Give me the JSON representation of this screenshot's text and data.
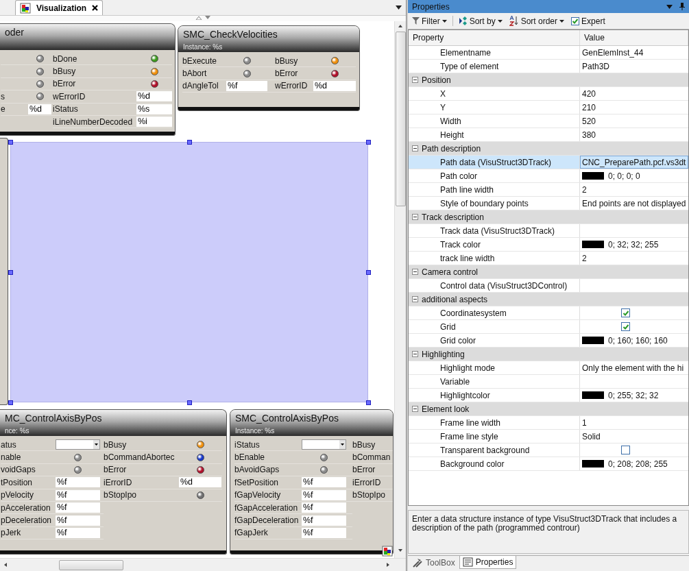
{
  "editor": {
    "tabs": [
      {
        "label": "Visualization",
        "selected": true
      }
    ]
  },
  "canvas": {
    "blocks": [
      {
        "title": "oder",
        "columns": [
          [
            {
              "kind": "lamp",
              "color": "#8a8a8a"
            },
            {
              "kind": "lamp",
              "color": "#8a8a8a"
            },
            {
              "kind": "lamp",
              "color": "#8a8a8a"
            },
            {
              "label": "s",
              "kind": "lamp",
              "color": "#8a8a8a"
            },
            {
              "label": "e",
              "kind": "field",
              "value": "%d"
            }
          ],
          [
            {
              "label": "bDone",
              "kind": "lamp",
              "color": "#3c9a1c"
            },
            {
              "label": "bBusy",
              "kind": "lamp",
              "color": "#f0900c"
            },
            {
              "label": "bError",
              "kind": "lamp",
              "color": "#b0102a"
            },
            {
              "label": "wErrorID",
              "kind": "field",
              "value": "%d"
            },
            {
              "label": "iStatus",
              "kind": "field",
              "value": "%s"
            },
            {
              "label": "iLineNumberDecoded",
              "kind": "field",
              "value": "%i"
            }
          ]
        ]
      },
      {
        "title": "SMC_CheckVelocities",
        "instance": "Instance: %s",
        "columns": [
          [
            {
              "label": "bExecute",
              "kind": "lamp",
              "color": "#8a8a8a"
            },
            {
              "label": "bAbort",
              "kind": "lamp",
              "color": "#8a8a8a"
            },
            {
              "label": "dAngleTol",
              "kind": "field",
              "value": "%f"
            }
          ],
          [
            {
              "label": "bBusy",
              "kind": "lamp",
              "color": "#f0900c"
            },
            {
              "label": "bError",
              "kind": "lamp",
              "color": "#b0102a"
            },
            {
              "label": "wErrorID",
              "kind": "field",
              "value": "%d"
            }
          ]
        ]
      },
      {
        "title": "MC_ControlAxisByPos",
        "instance": "nce: %s",
        "columns": [
          [
            {
              "label": "atus",
              "kind": "dropdown"
            },
            {
              "label": "nable",
              "kind": "lamp",
              "color": "#8a8a8a"
            },
            {
              "label": "voidGaps",
              "kind": "lamp",
              "color": "#8a8a8a"
            },
            {
              "label": "tPosition",
              "kind": "field",
              "value": "%f"
            },
            {
              "label": "pVelocity",
              "kind": "field",
              "value": "%f"
            },
            {
              "label": "pAcceleration",
              "kind": "field",
              "value": "%f"
            },
            {
              "label": "pDeceleration",
              "kind": "field",
              "value": "%f"
            },
            {
              "label": "pJerk",
              "kind": "field",
              "value": "%f"
            }
          ],
          [
            {
              "label": "bBusy",
              "kind": "lamp",
              "color": "#f0900c"
            },
            {
              "label": "bCommandAbortec",
              "kind": "lamp",
              "color": "#1838c8"
            },
            {
              "label": "bError",
              "kind": "lamp",
              "color": "#b0102a"
            },
            {
              "label": "iErrorID",
              "kind": "field",
              "value": "%d"
            },
            {
              "label": "bStopIpo",
              "kind": "lamp",
              "color": "#707070"
            }
          ]
        ]
      },
      {
        "title": "SMC_ControlAxisByPos",
        "instance": "Instance: %s",
        "columns": [
          [
            {
              "label": "iStatus",
              "kind": "dropdown"
            },
            {
              "label": "bEnable",
              "kind": "lamp",
              "color": "#8a8a8a"
            },
            {
              "label": "bAvoidGaps",
              "kind": "lamp",
              "color": "#8a8a8a"
            },
            {
              "label": "fSetPosition",
              "kind": "field",
              "value": "%f"
            },
            {
              "label": "fGapVelocity",
              "kind": "field",
              "value": "%f"
            },
            {
              "label": "fGapAcceleration",
              "kind": "field",
              "value": "%f"
            },
            {
              "label": "fGapDeceleration",
              "kind": "field",
              "value": "%f"
            },
            {
              "label": "fGapJerk",
              "kind": "field",
              "value": "%f"
            }
          ],
          [
            {
              "label": "bBusy",
              "kind": "label"
            },
            {
              "label": "bComman",
              "kind": "label"
            },
            {
              "label": "bError",
              "kind": "label"
            },
            {
              "label": "iErrorID",
              "kind": "label"
            },
            {
              "label": "bStopIpo",
              "kind": "label"
            }
          ]
        ]
      }
    ]
  },
  "properties": {
    "title": "Properties",
    "toolbar": [
      {
        "label": "Filter",
        "kind": "filter"
      },
      {
        "label": "Sort by",
        "kind": "sort"
      },
      {
        "label": "Sort order",
        "kind": "order"
      },
      {
        "label": "Expert",
        "kind": "checkbox",
        "checked": true
      }
    ],
    "columns": [
      "Property",
      "Value"
    ],
    "rows": [
      {
        "kind": "property",
        "name": "Elementname",
        "value": "GenElemInst_44",
        "selected": false
      },
      {
        "kind": "property",
        "name": "Type of element",
        "value": "Path3D",
        "selected": false
      },
      {
        "kind": "category",
        "name": "Position",
        "expanded": true,
        "children": [
          {
            "kind": "property",
            "name": "X",
            "value": "420",
            "selected": false
          },
          {
            "kind": "property",
            "name": "Y",
            "value": "210",
            "selected": false
          },
          {
            "kind": "property",
            "name": "Width",
            "value": "520",
            "selected": false
          },
          {
            "kind": "property",
            "name": "Height",
            "value": "380",
            "selected": false
          }
        ]
      },
      {
        "kind": "category",
        "name": "Path description",
        "expanded": true,
        "children": [
          {
            "kind": "property",
            "name": "Path data (VisuStruct3DTrack)",
            "value": "CNC_PreparePath.pcf.vs3dt",
            "selected": true
          },
          {
            "kind": "color",
            "name": "Path color",
            "value": "0; 0; 0; 0",
            "selected": false
          },
          {
            "kind": "property",
            "name": "Path line width",
            "value": "2",
            "selected": false
          },
          {
            "kind": "property",
            "name": "Style of boundary points",
            "value": "End points are not displayed",
            "selected": false
          }
        ]
      },
      {
        "kind": "category",
        "name": "Track description",
        "expanded": true,
        "children": [
          {
            "kind": "property",
            "name": "Track data (VisuStruct3DTrack)",
            "selected": false
          },
          {
            "kind": "color",
            "name": "Track color",
            "value": "0; 32; 32; 255",
            "selected": false
          },
          {
            "kind": "property",
            "name": "track line width",
            "value": "2",
            "selected": false
          }
        ]
      },
      {
        "kind": "category",
        "name": "Camera control",
        "expanded": true,
        "children": [
          {
            "kind": "property",
            "name": "Control data (VisuStruct3DControl)",
            "selected": false
          }
        ]
      },
      {
        "kind": "category",
        "name": "additional aspects",
        "expanded": true,
        "children": [
          {
            "kind": "checkbox",
            "name": "Coordinatesystem",
            "checked": true,
            "selected": false
          },
          {
            "kind": "checkbox",
            "name": "Grid",
            "checked": true,
            "selected": false
          },
          {
            "kind": "color",
            "name": "Grid color",
            "value": "0; 160; 160; 160",
            "selected": false
          }
        ]
      },
      {
        "kind": "category",
        "name": "Highlighting",
        "expanded": true,
        "children": [
          {
            "kind": "property",
            "name": "Highlight mode",
            "value": "Only the element with the hi",
            "selected": false
          },
          {
            "kind": "property",
            "name": "Variable",
            "selected": false
          },
          {
            "kind": "color",
            "name": "Highlightcolor",
            "value": "0; 255; 32; 32",
            "selected": false
          }
        ]
      },
      {
        "kind": "category",
        "name": "Element look",
        "expanded": true,
        "children": [
          {
            "kind": "property",
            "name": "Frame line width",
            "value": "1",
            "selected": false
          },
          {
            "kind": "property",
            "name": "Frame line style",
            "value": "Solid",
            "selected": false
          },
          {
            "kind": "checkbox",
            "name": "Transparent background",
            "checked": false,
            "selected": false
          },
          {
            "kind": "color",
            "name": "Background color",
            "value": "0; 208; 208; 255",
            "selected": false
          }
        ]
      }
    ],
    "description": "Enter a data structure instance of type VisuStruct3DTrack that includes a description of the path (programmed controur)",
    "tabs": [
      {
        "label": "ToolBox",
        "kind": "toolbox",
        "selected": false
      },
      {
        "label": "Properties",
        "kind": "properties",
        "selected": true
      }
    ]
  }
}
